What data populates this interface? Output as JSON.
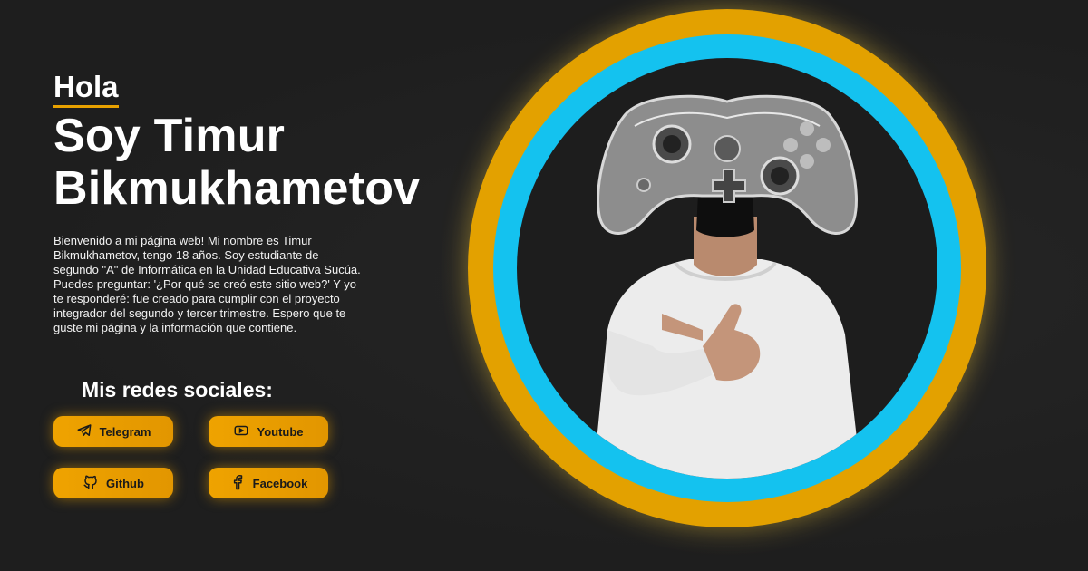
{
  "hero": {
    "greeting": "Hola",
    "name_line1": "Soy Timur",
    "name_line2": "Bikmukhametov",
    "bio": "Bienvenido a mi página web! Mi nombre es Timur Bikmukhametov, tengo 18 años. Soy estudiante de segundo \"A\" de Informática en la Unidad Educativa Sucúa. Puedes preguntar: '¿Por qué se creó este sitio web?' Y yo te responderé: fue creado para cumplir con el proyecto integrador del segundo y tercer trimestre. Espero que te guste mi página y la información que contiene."
  },
  "social": {
    "title": "Mis redes sociales:",
    "buttons": [
      {
        "label": "Telegram",
        "icon": "telegram-icon"
      },
      {
        "label": "Youtube",
        "icon": "youtube-icon"
      },
      {
        "label": "Github",
        "icon": "github-icon"
      },
      {
        "label": "Facebook",
        "icon": "facebook-icon"
      }
    ]
  },
  "colors": {
    "background": "#1e1e1e",
    "accent_orange": "#e3a100",
    "accent_blue": "#14c2ef",
    "text": "#ffffff"
  },
  "image": {
    "subject": "portrait-photo"
  }
}
